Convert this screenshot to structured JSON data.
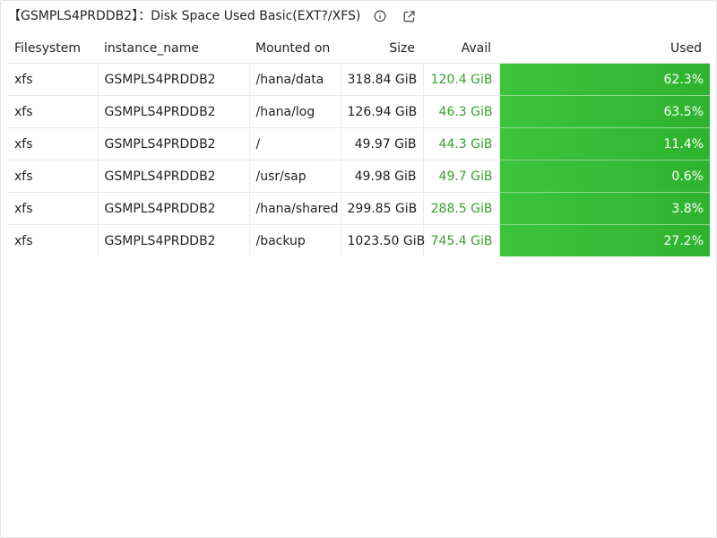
{
  "panel": {
    "title": "【GSMPLS4PRDDB2】：Disk Space Used Basic(EXT?/XFS)",
    "info_icon": "info-circle-icon",
    "link_icon": "external-link-icon"
  },
  "table": {
    "columns": [
      "Filesystem",
      "instance_name",
      "Mounted on",
      "Size",
      "Avail",
      "Used"
    ],
    "rows": [
      {
        "filesystem": "xfs",
        "instance": "GSMPLS4PRDDB2",
        "mount": "/hana/data",
        "size": "318.84 GiB",
        "avail": "120.4 GiB",
        "used": "62.3%"
      },
      {
        "filesystem": "xfs",
        "instance": "GSMPLS4PRDDB2",
        "mount": "/hana/log",
        "size": "126.94 GiB",
        "avail": "46.3 GiB",
        "used": "63.5%"
      },
      {
        "filesystem": "xfs",
        "instance": "GSMPLS4PRDDB2",
        "mount": "/",
        "size": "49.97 GiB",
        "avail": "44.3 GiB",
        "used": "11.4%"
      },
      {
        "filesystem": "xfs",
        "instance": "GSMPLS4PRDDB2",
        "mount": "/usr/sap",
        "size": "49.98 GiB",
        "avail": "49.7 GiB",
        "used": "0.6%"
      },
      {
        "filesystem": "xfs",
        "instance": "GSMPLS4PRDDB2",
        "mount": "/hana/shared",
        "size": "299.85 GiB",
        "avail": "288.5 GiB",
        "used": "3.8%"
      },
      {
        "filesystem": "xfs",
        "instance": "GSMPLS4PRDDB2",
        "mount": "/backup",
        "size": "1023.50 GiB",
        "avail": "745.4 GiB",
        "used": "27.2%"
      }
    ]
  },
  "colors": {
    "avail_text": "#37a02d",
    "used_cell_bg": "#3cc43c",
    "used_text": "#ffffff"
  }
}
